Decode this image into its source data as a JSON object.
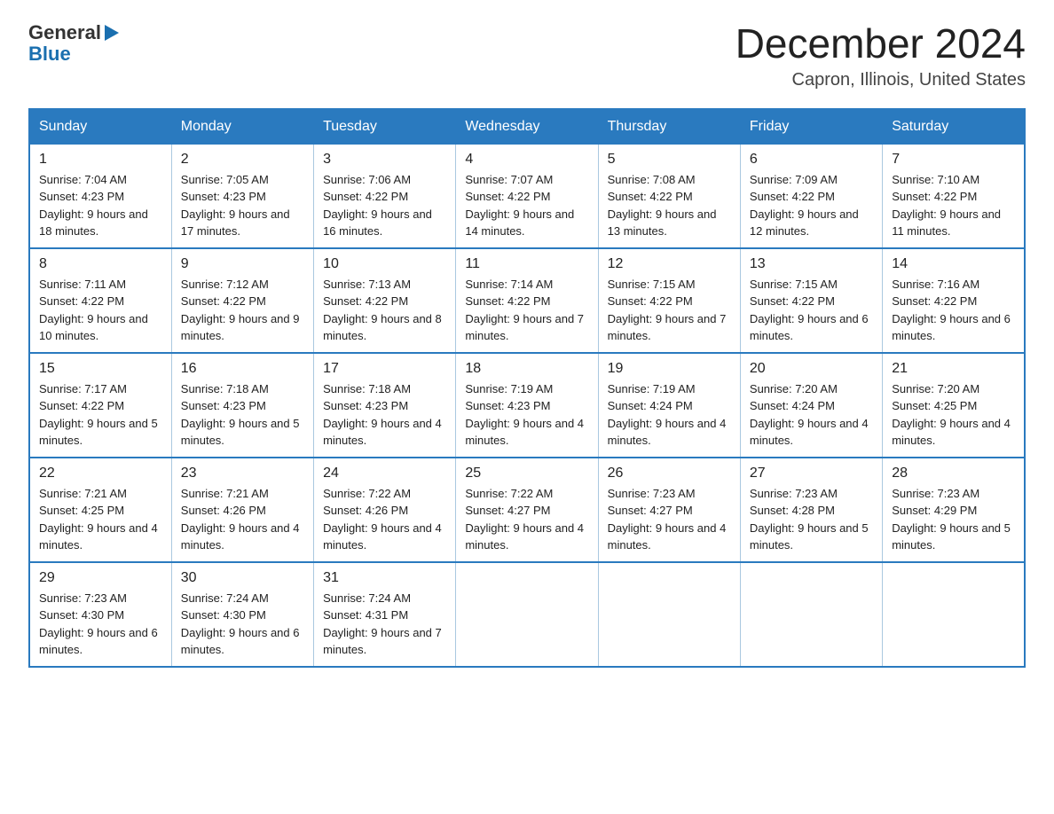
{
  "header": {
    "logo_general": "General",
    "logo_blue": "Blue",
    "month_title": "December 2024",
    "location": "Capron, Illinois, United States"
  },
  "weekdays": [
    "Sunday",
    "Monday",
    "Tuesday",
    "Wednesday",
    "Thursday",
    "Friday",
    "Saturday"
  ],
  "weeks": [
    [
      {
        "day": "1",
        "sunrise": "7:04 AM",
        "sunset": "4:23 PM",
        "daylight": "9 hours and 18 minutes."
      },
      {
        "day": "2",
        "sunrise": "7:05 AM",
        "sunset": "4:23 PM",
        "daylight": "9 hours and 17 minutes."
      },
      {
        "day": "3",
        "sunrise": "7:06 AM",
        "sunset": "4:22 PM",
        "daylight": "9 hours and 16 minutes."
      },
      {
        "day": "4",
        "sunrise": "7:07 AM",
        "sunset": "4:22 PM",
        "daylight": "9 hours and 14 minutes."
      },
      {
        "day": "5",
        "sunrise": "7:08 AM",
        "sunset": "4:22 PM",
        "daylight": "9 hours and 13 minutes."
      },
      {
        "day": "6",
        "sunrise": "7:09 AM",
        "sunset": "4:22 PM",
        "daylight": "9 hours and 12 minutes."
      },
      {
        "day": "7",
        "sunrise": "7:10 AM",
        "sunset": "4:22 PM",
        "daylight": "9 hours and 11 minutes."
      }
    ],
    [
      {
        "day": "8",
        "sunrise": "7:11 AM",
        "sunset": "4:22 PM",
        "daylight": "9 hours and 10 minutes."
      },
      {
        "day": "9",
        "sunrise": "7:12 AM",
        "sunset": "4:22 PM",
        "daylight": "9 hours and 9 minutes."
      },
      {
        "day": "10",
        "sunrise": "7:13 AM",
        "sunset": "4:22 PM",
        "daylight": "9 hours and 8 minutes."
      },
      {
        "day": "11",
        "sunrise": "7:14 AM",
        "sunset": "4:22 PM",
        "daylight": "9 hours and 7 minutes."
      },
      {
        "day": "12",
        "sunrise": "7:15 AM",
        "sunset": "4:22 PM",
        "daylight": "9 hours and 7 minutes."
      },
      {
        "day": "13",
        "sunrise": "7:15 AM",
        "sunset": "4:22 PM",
        "daylight": "9 hours and 6 minutes."
      },
      {
        "day": "14",
        "sunrise": "7:16 AM",
        "sunset": "4:22 PM",
        "daylight": "9 hours and 6 minutes."
      }
    ],
    [
      {
        "day": "15",
        "sunrise": "7:17 AM",
        "sunset": "4:22 PM",
        "daylight": "9 hours and 5 minutes."
      },
      {
        "day": "16",
        "sunrise": "7:18 AM",
        "sunset": "4:23 PM",
        "daylight": "9 hours and 5 minutes."
      },
      {
        "day": "17",
        "sunrise": "7:18 AM",
        "sunset": "4:23 PM",
        "daylight": "9 hours and 4 minutes."
      },
      {
        "day": "18",
        "sunrise": "7:19 AM",
        "sunset": "4:23 PM",
        "daylight": "9 hours and 4 minutes."
      },
      {
        "day": "19",
        "sunrise": "7:19 AM",
        "sunset": "4:24 PM",
        "daylight": "9 hours and 4 minutes."
      },
      {
        "day": "20",
        "sunrise": "7:20 AM",
        "sunset": "4:24 PM",
        "daylight": "9 hours and 4 minutes."
      },
      {
        "day": "21",
        "sunrise": "7:20 AM",
        "sunset": "4:25 PM",
        "daylight": "9 hours and 4 minutes."
      }
    ],
    [
      {
        "day": "22",
        "sunrise": "7:21 AM",
        "sunset": "4:25 PM",
        "daylight": "9 hours and 4 minutes."
      },
      {
        "day": "23",
        "sunrise": "7:21 AM",
        "sunset": "4:26 PM",
        "daylight": "9 hours and 4 minutes."
      },
      {
        "day": "24",
        "sunrise": "7:22 AM",
        "sunset": "4:26 PM",
        "daylight": "9 hours and 4 minutes."
      },
      {
        "day": "25",
        "sunrise": "7:22 AM",
        "sunset": "4:27 PM",
        "daylight": "9 hours and 4 minutes."
      },
      {
        "day": "26",
        "sunrise": "7:23 AM",
        "sunset": "4:27 PM",
        "daylight": "9 hours and 4 minutes."
      },
      {
        "day": "27",
        "sunrise": "7:23 AM",
        "sunset": "4:28 PM",
        "daylight": "9 hours and 5 minutes."
      },
      {
        "day": "28",
        "sunrise": "7:23 AM",
        "sunset": "4:29 PM",
        "daylight": "9 hours and 5 minutes."
      }
    ],
    [
      {
        "day": "29",
        "sunrise": "7:23 AM",
        "sunset": "4:30 PM",
        "daylight": "9 hours and 6 minutes."
      },
      {
        "day": "30",
        "sunrise": "7:24 AM",
        "sunset": "4:30 PM",
        "daylight": "9 hours and 6 minutes."
      },
      {
        "day": "31",
        "sunrise": "7:24 AM",
        "sunset": "4:31 PM",
        "daylight": "9 hours and 7 minutes."
      },
      null,
      null,
      null,
      null
    ]
  ]
}
